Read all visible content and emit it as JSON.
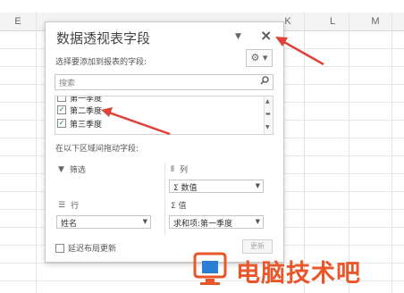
{
  "sheet": {
    "columns": [
      "E",
      "K",
      "L",
      "M"
    ]
  },
  "pane": {
    "title": "数据透视表字段",
    "close_glyph": "×",
    "dropdown_glyph": "▼",
    "choose_label": "选择要添加到报表的字段:",
    "gear_glyph": "⚙ ▾",
    "search_placeholder": "搜索",
    "search_icon": "search-icon",
    "fields": [
      {
        "label": "第一季度",
        "checked": false,
        "partial": true
      },
      {
        "label": "第二季度",
        "checked": true
      },
      {
        "label": "第三季度",
        "checked": true
      }
    ],
    "drag_label": "在以下区域间拖动字段:",
    "areas": {
      "filter": {
        "label": "筛选",
        "icon": "filter-icon"
      },
      "columns": {
        "label": "列",
        "icon": "columns-icon",
        "value": "Σ 数值"
      },
      "rows": {
        "label": "行",
        "icon": "rows-icon",
        "value": "姓名"
      },
      "values": {
        "label": "Σ 值",
        "icon": "sigma-icon",
        "value": "求和项:第一季度"
      }
    },
    "defer_label": "延迟布局更新",
    "update_label": "更新"
  },
  "watermark": {
    "text": "电脑技术吧",
    "brand_color": "#e8562a",
    "icon_color": "#2a7fd4"
  }
}
